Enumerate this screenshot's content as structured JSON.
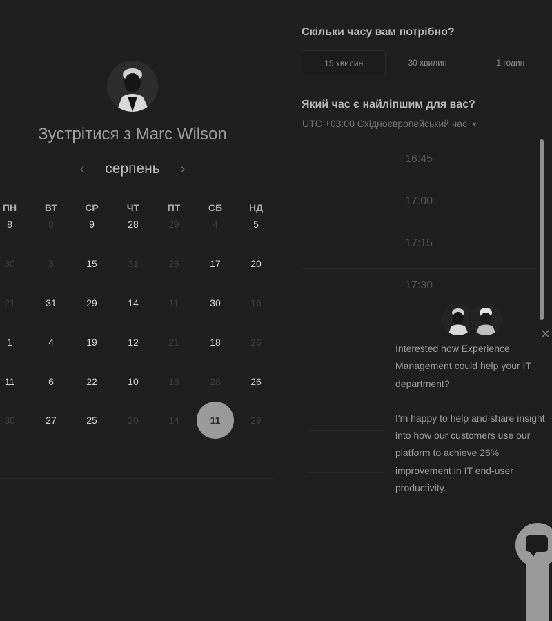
{
  "host": {
    "meet_label": "Зустрітися з Marc Wilson",
    "avatar_icon": "person-avatar-icon"
  },
  "calendar": {
    "prev_icon": "‹",
    "next_icon": "›",
    "month": "серпень",
    "weekdays": [
      "ПН",
      "ВТ",
      "СР",
      "ЧТ",
      "ПТ",
      "СБ",
      "НД"
    ],
    "weeks": [
      [
        {
          "d": "8",
          "on": true
        },
        {
          "d": "8",
          "on": false
        },
        {
          "d": "9",
          "on": true
        },
        {
          "d": "28",
          "on": true
        },
        {
          "d": "29",
          "on": false
        },
        {
          "d": "4",
          "on": false
        },
        {
          "d": "5",
          "on": true
        }
      ],
      [
        {
          "d": "30",
          "on": false
        },
        {
          "d": "3",
          "on": false
        },
        {
          "d": "15",
          "on": true
        },
        {
          "d": "31",
          "on": false
        },
        {
          "d": "26",
          "on": false
        },
        {
          "d": "17",
          "on": true
        },
        {
          "d": "20",
          "on": true
        }
      ],
      [
        {
          "d": "21",
          "on": false
        },
        {
          "d": "31",
          "on": true
        },
        {
          "d": "29",
          "on": true
        },
        {
          "d": "14",
          "on": true
        },
        {
          "d": "11",
          "on": false
        },
        {
          "d": "30",
          "on": true
        },
        {
          "d": "16",
          "on": false
        }
      ],
      [
        {
          "d": "1",
          "on": true
        },
        {
          "d": "4",
          "on": true
        },
        {
          "d": "19",
          "on": true
        },
        {
          "d": "12",
          "on": true
        },
        {
          "d": "21",
          "on": false
        },
        {
          "d": "18",
          "on": true
        },
        {
          "d": "26",
          "on": false
        }
      ],
      [
        {
          "d": "11",
          "on": true
        },
        {
          "d": "6",
          "on": true
        },
        {
          "d": "22",
          "on": true
        },
        {
          "d": "10",
          "on": true
        },
        {
          "d": "18",
          "on": false
        },
        {
          "d": "28",
          "on": false
        },
        {
          "d": "26",
          "on": true
        }
      ],
      [
        {
          "d": "30",
          "on": false
        },
        {
          "d": "27",
          "on": true
        },
        {
          "d": "25",
          "on": true
        },
        {
          "d": "20",
          "on": false
        },
        {
          "d": "14",
          "on": false
        },
        {
          "d": "11",
          "on": true,
          "selected": true
        },
        {
          "d": "29",
          "on": false
        }
      ]
    ]
  },
  "duration": {
    "question": "Скільки часу вам потрібно?",
    "options": [
      "15 хвилин",
      "30 хвилин",
      "1 годин"
    ],
    "selected_index": 0
  },
  "time": {
    "question": "Який час є найліпшим для вас?",
    "timezone": "UTC +03:00 Східноєвропейський час",
    "timezone_caret_icon": "caret-down-icon",
    "slots": [
      "16:45",
      "17:00",
      "17:15",
      "17:30"
    ]
  },
  "chat": {
    "close_icon": "✕",
    "message_1": "Interested how Experience Management could help your IT department?",
    "message_2": "I'm happy to help and share insight into how our customers use our platform to achieve 26% improvement in IT end-user productivity.",
    "launcher_icon": "chat-bubble-icon"
  },
  "colors": {
    "background": "#1e1e1e",
    "selected_day": "#9a9a9a"
  }
}
